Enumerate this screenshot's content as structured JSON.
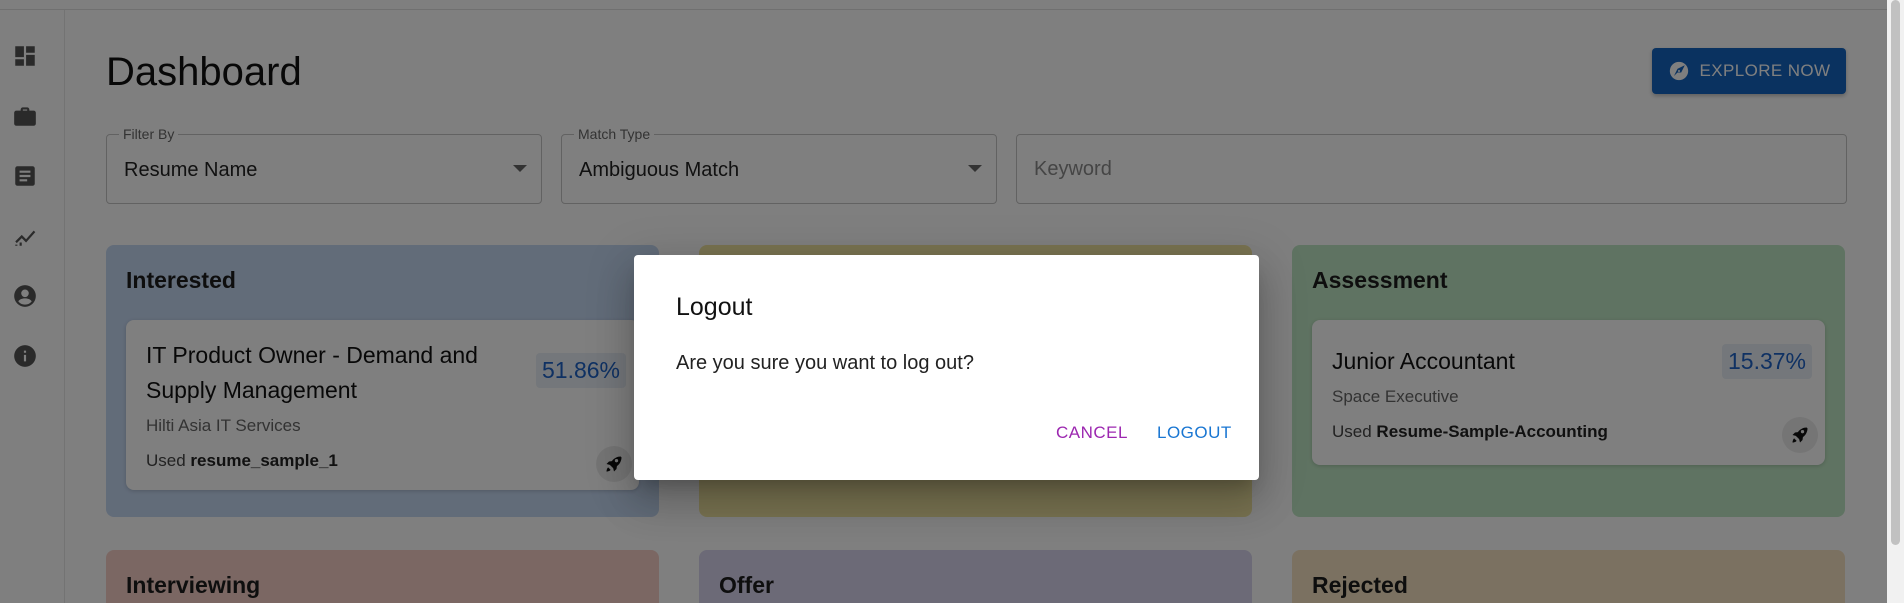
{
  "app": {
    "page_title": "Dashboard",
    "explore_button": {
      "label": "EXPLORE NOW",
      "icon": "compass-icon"
    }
  },
  "sidebar": {
    "items": [
      {
        "name": "dashboard",
        "icon": "dashboard-icon"
      },
      {
        "name": "jobs",
        "icon": "briefcase-icon"
      },
      {
        "name": "resumes",
        "icon": "document-icon"
      },
      {
        "name": "analytics",
        "icon": "chart-icon"
      },
      {
        "name": "profile",
        "icon": "account-icon"
      },
      {
        "name": "about",
        "icon": "info-icon"
      }
    ]
  },
  "filters": {
    "filter_by": {
      "label": "Filter By",
      "value": "Resume Name"
    },
    "match_type": {
      "label": "Match Type",
      "value": "Ambiguous Match"
    },
    "keyword": {
      "placeholder": "Keyword",
      "value": ""
    }
  },
  "columns": [
    {
      "title": "Interested",
      "color": "#c5d8f3",
      "cards": [
        {
          "title_line1": "IT Product Owner - Demand and",
          "title_line2": "Supply Management",
          "company": "Hilti Asia IT Services",
          "used_prefix": "Used",
          "resume": "resume_sample_1",
          "match": "51.86%"
        }
      ]
    },
    {
      "title": "",
      "color": "#f3e7a3",
      "cards": []
    },
    {
      "title": "Assessment",
      "color": "#bfe7c4",
      "cards": [
        {
          "title": "Junior Accountant",
          "company": "Space Executive",
          "used_prefix": "Used",
          "resume": "Resume-Sample-Accounting",
          "match": "15.37%"
        }
      ]
    },
    {
      "title": "Interviewing",
      "color": "#f6cfc7"
    },
    {
      "title": "Offer",
      "color": "#d8d4ef"
    },
    {
      "title": "Rejected",
      "color": "#f6e3c3"
    }
  ],
  "dialog": {
    "title": "Logout",
    "message": "Are you sure you want to log out?",
    "cancel_label": "CANCEL",
    "logout_label": "LOGOUT",
    "cancel_color": "#9c27b0",
    "logout_color": "#1976d2"
  }
}
